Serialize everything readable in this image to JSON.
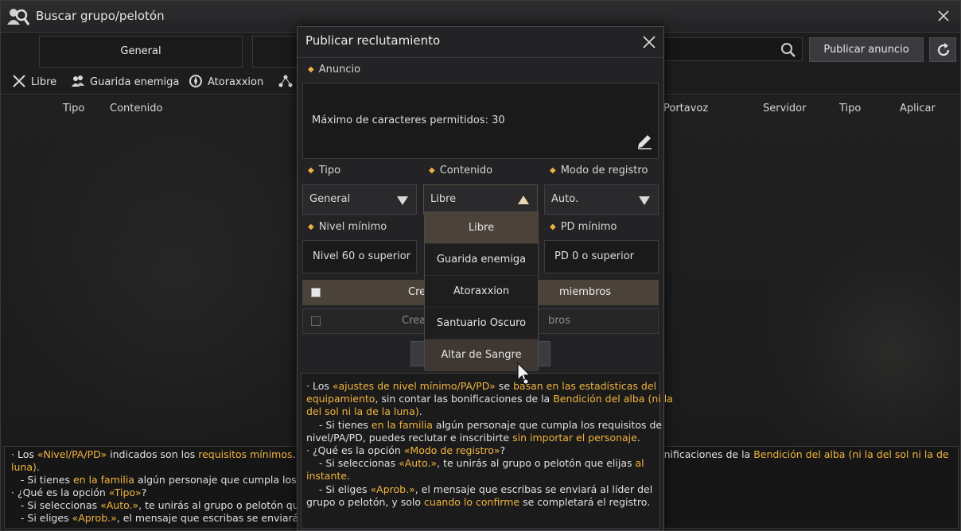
{
  "window": {
    "title": "Buscar grupo/pelotón"
  },
  "tabs": [
    {
      "label": "General"
    },
    {
      "label": ""
    }
  ],
  "header": {
    "publish_label": "Publicar anuncio",
    "search_placeholder": ""
  },
  "filters": [
    {
      "label": "Libre",
      "icon": "swords-icon"
    },
    {
      "label": "Guarida enemiga",
      "icon": "group-icon"
    },
    {
      "label": "Atoraxxion",
      "icon": "compass-icon"
    }
  ],
  "columns": {
    "left": [
      "Tipo",
      "Contenido"
    ],
    "right": [
      "Portavoz",
      "Servidor",
      "Tipo",
      "Aplicar"
    ]
  },
  "bottom_notes": [
    [
      {
        "t": "· Los ",
        "h": false
      },
      {
        "t": "«Nivel/PA/PD»",
        "h": true
      },
      {
        "t": " indicados son los ",
        "h": false
      },
      {
        "t": "requisitos mínimos",
        "h": true
      },
      {
        "t": ". ",
        "h": false
      }
    ],
    [
      {
        "t": "bonificaciones de la ",
        "h": false
      },
      {
        "t": "Bendición del alba (ni la del sol ni la de la",
        "h": true
      }
    ],
    [
      {
        "t": "luna)",
        "h": true
      },
      {
        "t": ".",
        "h": false
      }
    ],
    [
      {
        "t": "   - Si tienes ",
        "h": false
      },
      {
        "t": "en la familia",
        "h": true
      },
      {
        "t": " algún personaje que cumpla los req",
        "h": false
      }
    ],
    [
      {
        "t": "· ¿Qué es la opción ",
        "h": false
      },
      {
        "t": "«Tipo»",
        "h": true
      },
      {
        "t": "?",
        "h": false
      }
    ],
    [
      {
        "t": "   - Si seleccionas ",
        "h": false
      },
      {
        "t": "«Auto.»",
        "h": true
      },
      {
        "t": ", te unirás al grupo o pelotón que",
        "h": false
      }
    ],
    [
      {
        "t": "   - Si eliges ",
        "h": false
      },
      {
        "t": "«Aprob.»",
        "h": true
      },
      {
        "t": ", el mensaje que escribas se enviará al",
        "h": false
      }
    ]
  ],
  "modal": {
    "title": "Publicar reclutamiento",
    "announcement": {
      "label": "Anuncio",
      "placeholder": "Máximo de caracteres permitidos: 30"
    },
    "tipo": {
      "label": "Tipo",
      "value": "General"
    },
    "contenido": {
      "label": "Contenido",
      "value": "Libre"
    },
    "modo": {
      "label": "Modo de registro",
      "value": "Auto."
    },
    "nivel": {
      "label": "Nivel mínimo",
      "value": "Nivel 60 o superior"
    },
    "pd": {
      "label": "PD mínimo",
      "value": "PD 0 o superior"
    },
    "option1": {
      "label_left": "Crea",
      "label_right": "miembros"
    },
    "option2": {
      "label_left": "Crea",
      "label_right": "bros"
    },
    "dropdown": {
      "items": [
        "Libre",
        "Guarida enemiga",
        "Atoraxxion",
        "Santuario Oscuro",
        "Altar de Sangre"
      ],
      "selected": "Libre",
      "hovered": "Altar de Sangre"
    },
    "notes": [
      [
        {
          "t": "· Los ",
          "h": false
        },
        {
          "t": "«ajustes de nivel mínimo/PA/PD»",
          "h": true
        },
        {
          "t": " se ",
          "h": false
        },
        {
          "t": "basan en las estadísticas del",
          "h": true
        }
      ],
      [
        {
          "t": "equipamiento",
          "h": true
        },
        {
          "t": ", sin contar las bonificaciones de la ",
          "h": false
        },
        {
          "t": "Bendición del alba (ni la",
          "h": true
        }
      ],
      [
        {
          "t": "del sol ni la de la luna)",
          "h": true
        },
        {
          "t": ".",
          "h": false
        }
      ],
      [
        {
          "t": "    - Si tienes ",
          "h": false
        },
        {
          "t": "en la familia",
          "h": true
        },
        {
          "t": " algún personaje que cumpla los requisitos de",
          "h": false
        }
      ],
      [
        {
          "t": "nivel/PA/PD, puedes reclutar e inscribirte ",
          "h": false
        },
        {
          "t": "sin importar el personaje",
          "h": true
        },
        {
          "t": ".",
          "h": false
        }
      ],
      [
        {
          "t": "· ¿Qué es la opción ",
          "h": false
        },
        {
          "t": "«Modo de registro»",
          "h": true
        },
        {
          "t": "?",
          "h": false
        }
      ],
      [
        {
          "t": "    - Si seleccionas ",
          "h": false
        },
        {
          "t": "«Auto.»",
          "h": true
        },
        {
          "t": ", te unirás al grupo o pelotón que elijas ",
          "h": false
        },
        {
          "t": "al",
          "h": true
        }
      ],
      [
        {
          "t": "instante",
          "h": true
        },
        {
          "t": ".",
          "h": false
        }
      ],
      [
        {
          "t": "    - Si eliges ",
          "h": false
        },
        {
          "t": "«Aprob.»",
          "h": true
        },
        {
          "t": ", el mensaje que escribas se enviará al líder del",
          "h": false
        }
      ],
      [
        {
          "t": "grupo o pelotón, y solo ",
          "h": false
        },
        {
          "t": "cuando lo confirme",
          "h": true
        },
        {
          "t": " se completará el registro.",
          "h": false
        }
      ]
    ]
  },
  "colors": {
    "accent": "#f2b43a",
    "highlight_bg": "#4b4239"
  }
}
